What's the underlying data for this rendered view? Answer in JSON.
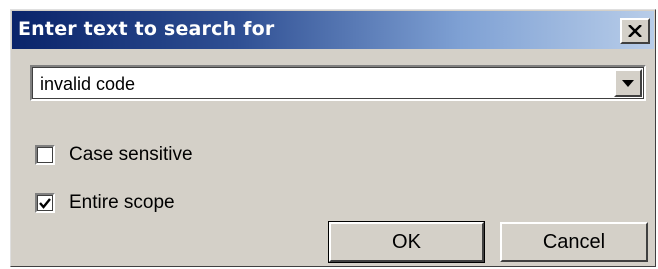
{
  "dialog": {
    "title": "Enter text to search for",
    "close_icon": "close-x-icon"
  },
  "search": {
    "value": "invalid code",
    "dropdown_icon": "chevron-down-icon"
  },
  "options": {
    "case_sensitive": {
      "label": "Case sensitive",
      "checked": false
    },
    "entire_scope": {
      "label": "Entire scope",
      "checked": true
    }
  },
  "buttons": {
    "ok_label": "OK",
    "cancel_label": "Cancel"
  },
  "colors": {
    "titlebar_start": "#0a246a",
    "titlebar_end": "#b8cde9",
    "face": "#d4d0c8"
  }
}
